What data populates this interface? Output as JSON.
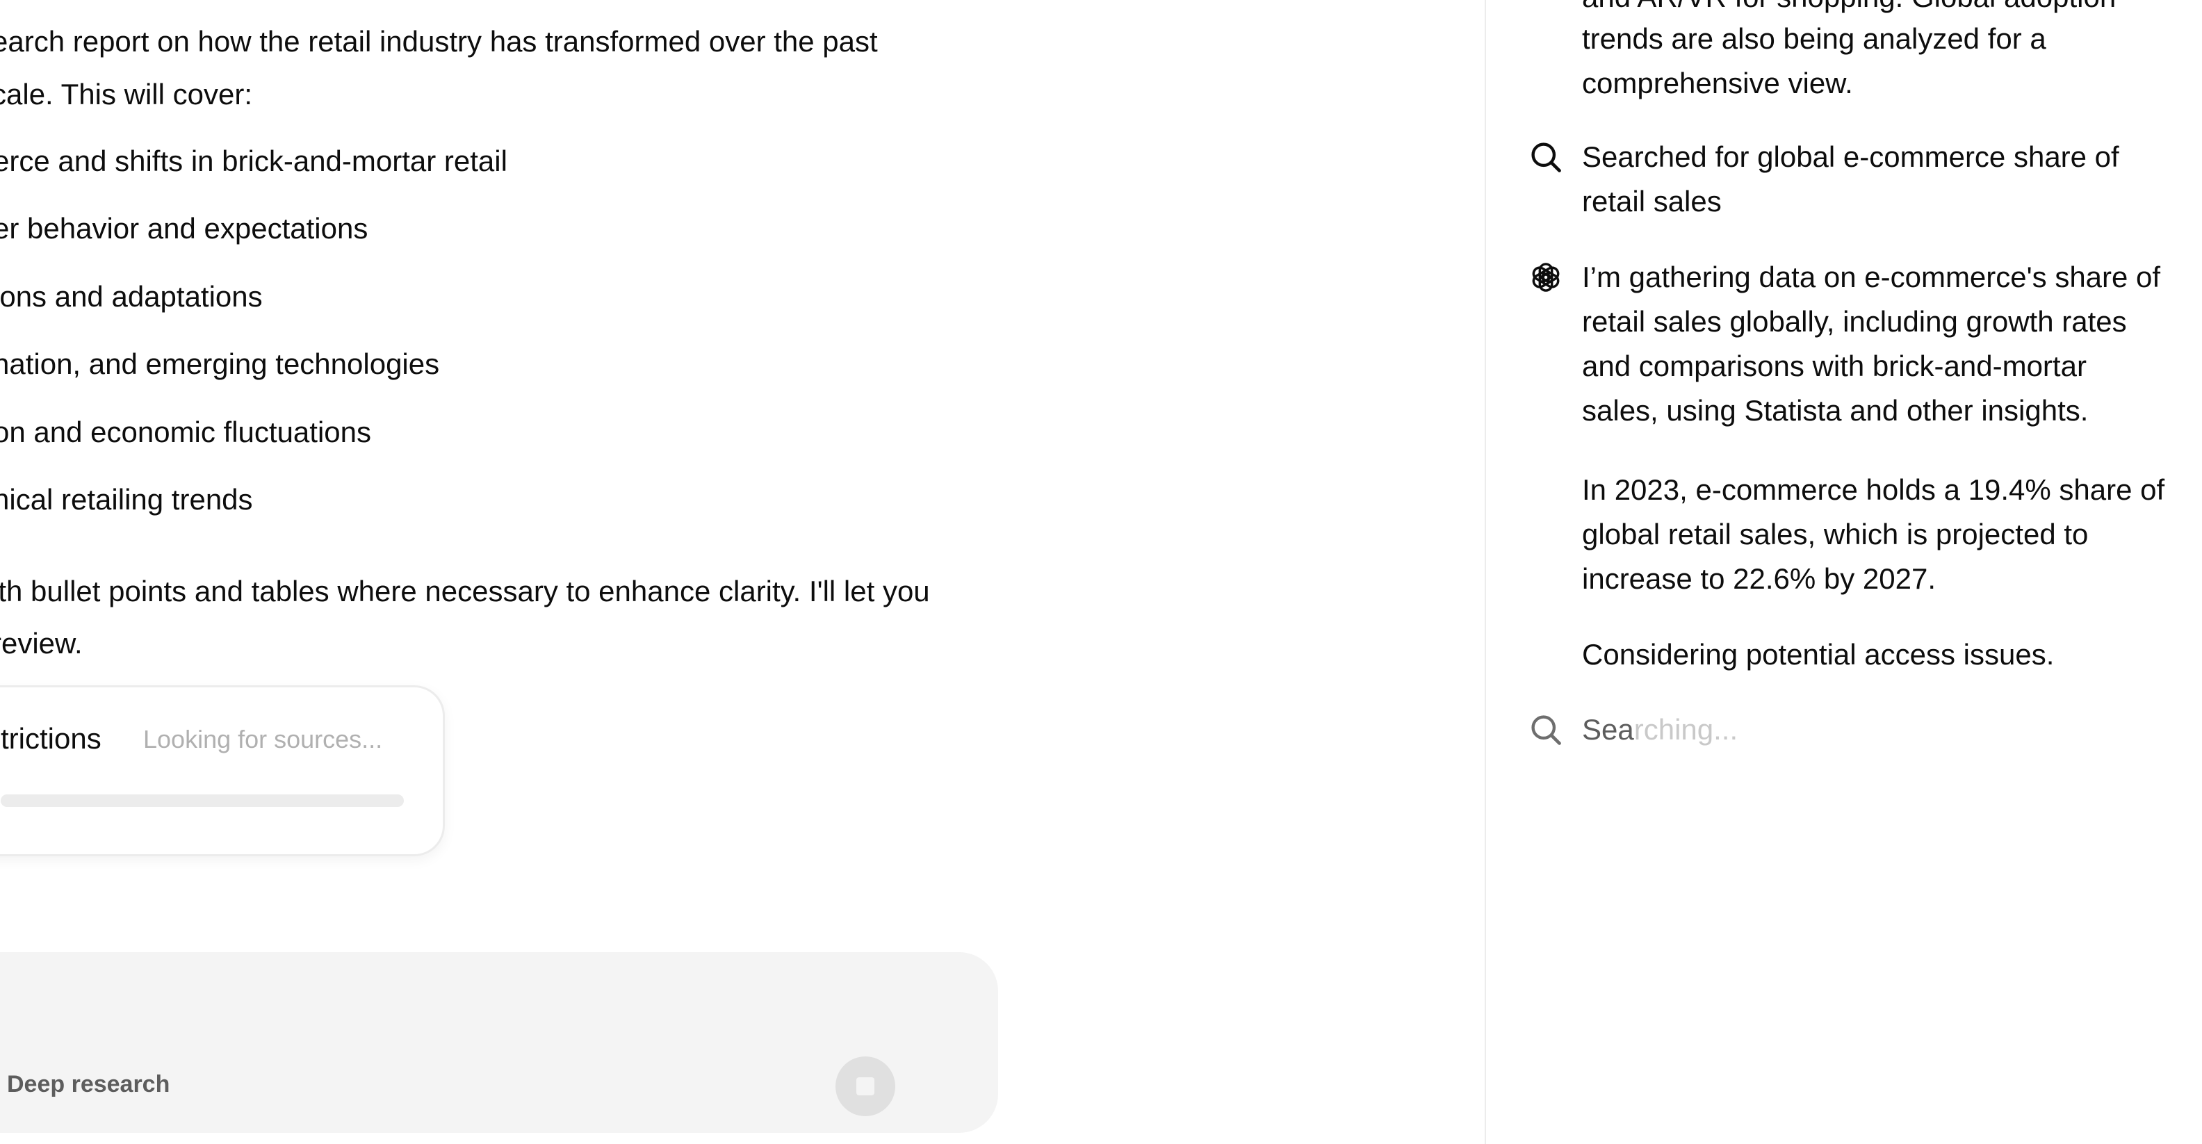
{
  "chat": {
    "intro_lines": [
      "earch report on how the retail industry has transformed over the past",
      "cale. This will cover:"
    ],
    "bullets": [
      "erce and shifts in brick-and-mortar retail",
      "er behavior and expectations",
      "ions and adaptations",
      "nation, and emerging technologies",
      "on and economic fluctuations",
      "hical retailing trends"
    ],
    "outro_lines": [
      "ith bullet points and tables where necessary to enhance clarity. I'll let you",
      "review."
    ]
  },
  "research_card": {
    "title": "trictions",
    "status": "Looking for sources...",
    "progress": 0.0
  },
  "composer": {
    "mode_label": "Deep research",
    "stop_icon": "stop-square-icon"
  },
  "activity": {
    "top_lines": [
      "and AR/VR for shopping. Global adoption",
      "trends are also being analyzed for a",
      "comprehensive view."
    ],
    "search": {
      "icon": "search-icon",
      "lines": [
        "Searched for global e-commerce share of",
        "retail sales"
      ]
    },
    "gathering": {
      "icon": "openai-logo-icon",
      "lines": [
        "I’m gathering data on e-commerce's share of",
        "retail sales globally, including growth rates",
        "and comparisons with brick-and-mortar",
        "sales, using Statista and other insights."
      ]
    },
    "stat_lines": [
      "In 2023, e-commerce holds a 19.4% share of",
      "global retail sales, which is projected to",
      "increase to 22.6% by 2027."
    ],
    "considering": "Considering potential access issues.",
    "searching": {
      "icon": "search-icon",
      "lead": "Sea",
      "rest": "rching..."
    }
  }
}
